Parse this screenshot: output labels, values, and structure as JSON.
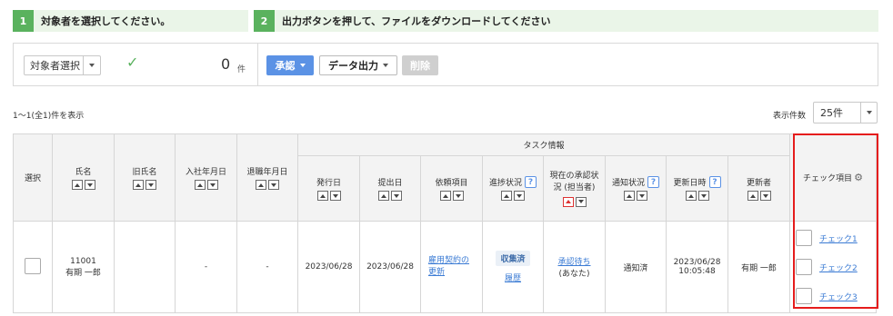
{
  "steps": [
    {
      "num": "1",
      "text": "対象者を選択してください。"
    },
    {
      "num": "2",
      "text": "出力ボタンを押して、ファイルをダウンロードしてください"
    }
  ],
  "toolbar": {
    "target_select": "対象者選択",
    "selected_count": "0",
    "count_unit": "件",
    "approve_label": "承認",
    "export_label": "データ出力",
    "delete_label": "削除"
  },
  "result_count": "1〜1(全1)件を表示",
  "page_size": {
    "label": "表示件数",
    "value": "25件"
  },
  "table": {
    "headers": {
      "select": "選択",
      "name": "氏名",
      "old_name": "旧氏名",
      "join_date": "入社年月日",
      "leave_date": "退職年月日",
      "task_info": "タスク情報",
      "issue_date": "発行日",
      "submit_date": "提出日",
      "request_item": "依頼項目",
      "progress": "進捗状況",
      "current_approval": "現在の承認状況 (担当者)",
      "notify_status": "通知状況",
      "updated_at": "更新日時",
      "updater": "更新者",
      "check_items": "チェック項目"
    },
    "help_symbol": "?",
    "rows": [
      {
        "employee_no": "11001",
        "name": "有期 一郎",
        "old_name": "",
        "join_date": "-",
        "leave_date": "-",
        "issue_date": "2023/06/28",
        "submit_date": "2023/06/28",
        "request_item": "雇用契約の更新",
        "progress": "収集済",
        "history": "履歴",
        "approval_status": "承認待ち",
        "approval_assignee": "(あなた)",
        "notify_status": "通知済",
        "updated_date": "2023/06/28",
        "updated_time": "10:05:48",
        "updater": "有期 一郎",
        "checks": [
          "チェック1",
          "チェック2",
          "チェック3"
        ]
      }
    ]
  },
  "colors": {
    "step_accent": "#5ab25e",
    "approve_button": "#5b92e5",
    "highlight": "#e51c1c",
    "link": "#3b7bd4"
  }
}
